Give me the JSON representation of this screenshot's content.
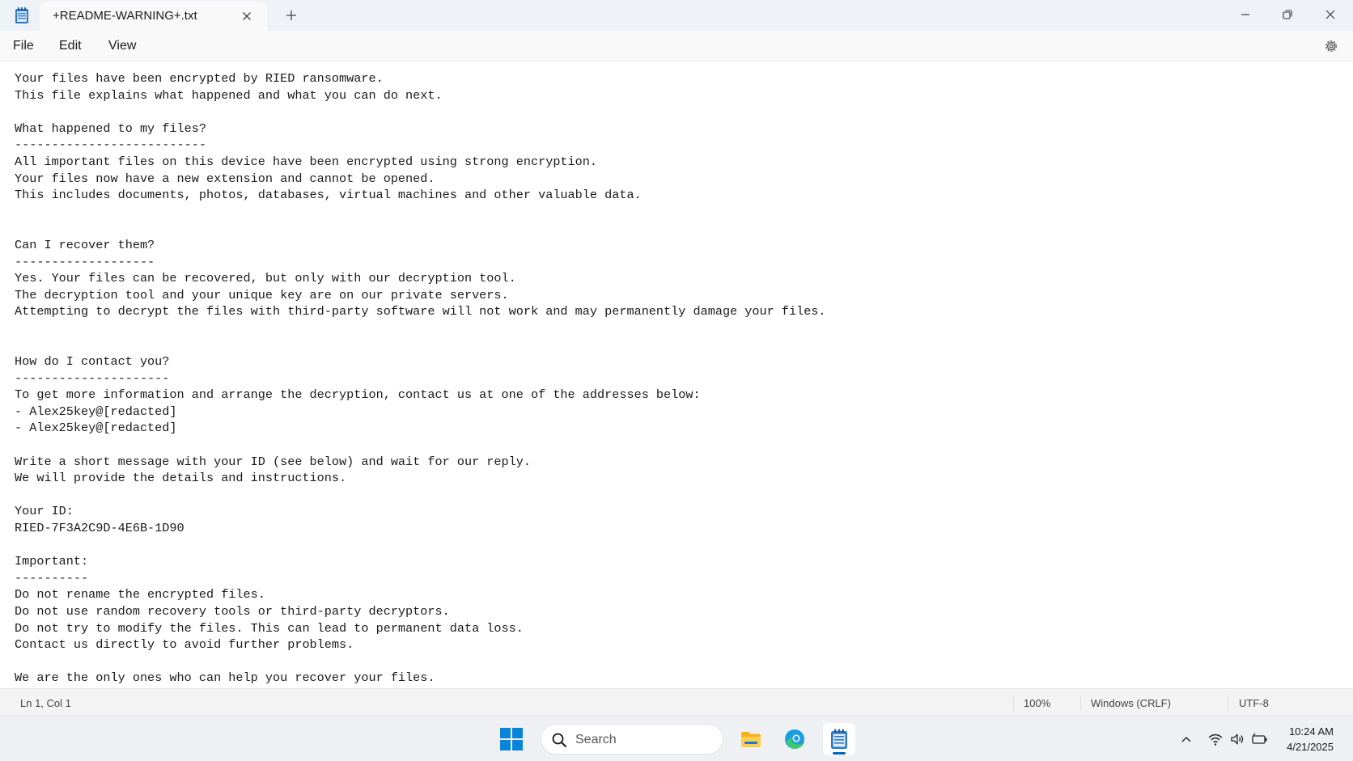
{
  "window": {
    "tab_title": "+README-WARNING+.txt",
    "menu": [
      "File",
      "Edit",
      "View"
    ]
  },
  "editor": {
    "lines": [
      "Your files have been encrypted by RIED ransomware.",
      "This file explains what happened and what you can do next.",
      "",
      "What happened to my files?",
      "--------------------------",
      "All important files on this device have been encrypted using strong encryption.",
      "Your files now have a new extension and cannot be opened.",
      "This includes documents, photos, databases, virtual machines and other valuable data.",
      "",
      "",
      "Can I recover them?",
      "-------------------",
      "Yes. Your files can be recovered, but only with our decryption tool.",
      "The decryption tool and your unique key are on our private servers.",
      "Attempting to decrypt the files with third-party software will not work and may permanently damage your files.",
      "",
      "",
      "How do I contact you?",
      "---------------------",
      "To get more information and arrange the decryption, contact us at one of the addresses below:",
      "- Alex25key@[redacted]",
      "- Alex25key@[redacted]",
      "",
      "Write a short message with your ID (see below) and wait for our reply.",
      "We will provide the details and instructions.",
      "",
      "Your ID:",
      "RIED-7F3A2C9D-4E6B-1D90",
      "",
      "Important:",
      "----------",
      "Do not rename the encrypted files.",
      "Do not use random recovery tools or third-party decryptors.",
      "Do not try to modify the files. This can lead to permanent data loss.",
      "Contact us directly to avoid further problems.",
      "",
      "We are the only ones who can help you recover your files."
    ]
  },
  "status": {
    "position": "Ln 1, Col 1",
    "zoom": "100%",
    "line_ending": "Windows (CRLF)",
    "encoding": "UTF-8"
  },
  "taskbar": {
    "search_label": "Search",
    "time": "10:24 AM",
    "date": "4/21/2025"
  },
  "colors": {
    "accent": "#0067c0",
    "notepad_icon": "#2a78c8",
    "folder_yellow": "#f5b21e"
  }
}
